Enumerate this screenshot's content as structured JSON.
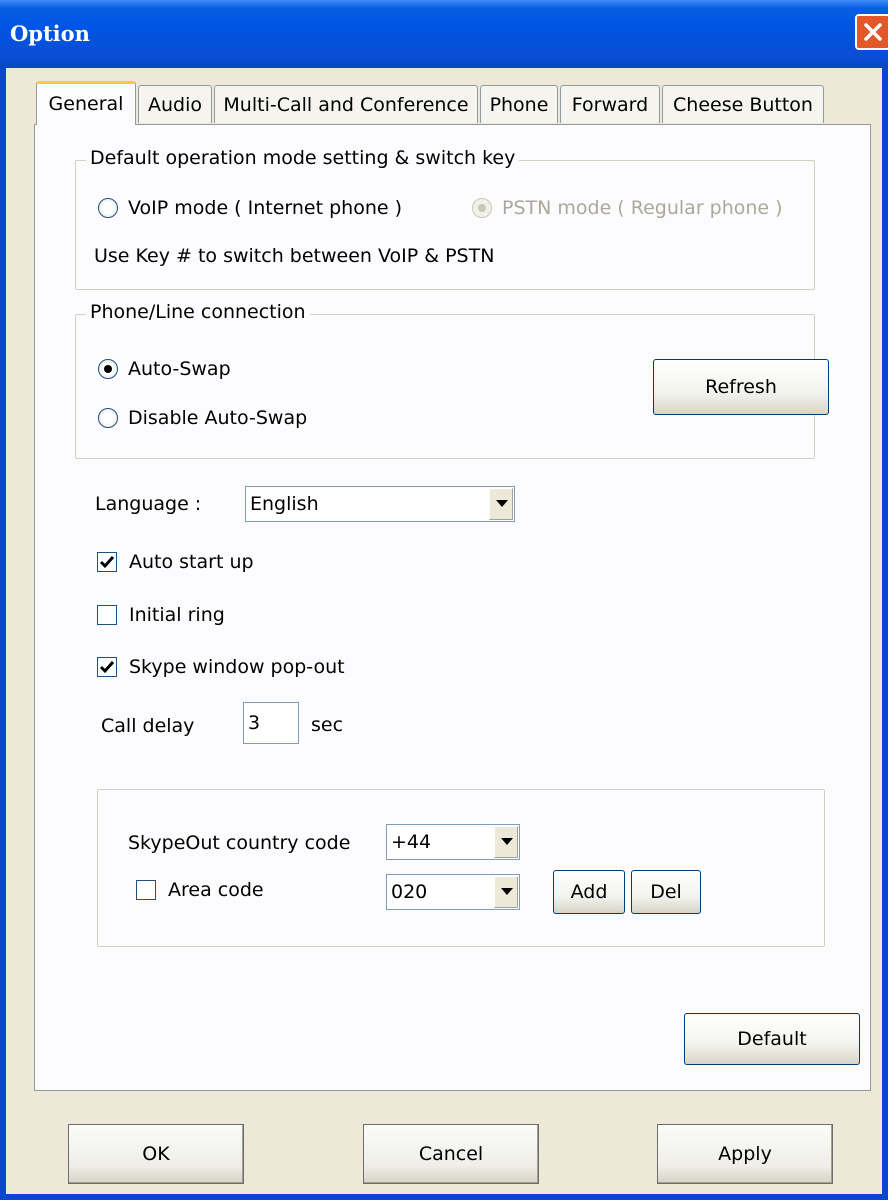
{
  "window": {
    "title": "Option"
  },
  "tabs": [
    "General",
    "Audio",
    "Multi-Call and Conference",
    "Phone",
    "Forward",
    "Cheese Button"
  ],
  "active_tab": "General",
  "mode_group": {
    "legend": "Default operation mode setting & switch key",
    "voip_label": "VoIP mode ( Internet phone )",
    "pstn_label": "PSTN mode ( Regular phone )",
    "switch_note": "Use Key # to switch between VoIP & PSTN"
  },
  "connection_group": {
    "legend": "Phone/Line connection",
    "auto_swap_label": "Auto-Swap",
    "disable_swap_label": "Disable Auto-Swap",
    "refresh_label": "Refresh"
  },
  "language": {
    "label": "Language :",
    "value": "English"
  },
  "options": {
    "auto_start_label": "Auto start up",
    "auto_start_checked": true,
    "initial_ring_label": "Initial ring",
    "initial_ring_checked": false,
    "popout_label": "Skype window pop-out",
    "popout_checked": true
  },
  "call_delay": {
    "label": "Call delay",
    "value": "3",
    "unit": "sec"
  },
  "skypeout": {
    "country_label": "SkypeOut country code",
    "country_value": "+44",
    "area_label": "Area code",
    "area_checked": false,
    "area_value": "020",
    "add_label": "Add",
    "del_label": "Del"
  },
  "buttons": {
    "default_label": "Default",
    "ok_label": "OK",
    "cancel_label": "Cancel",
    "apply_label": "Apply"
  }
}
